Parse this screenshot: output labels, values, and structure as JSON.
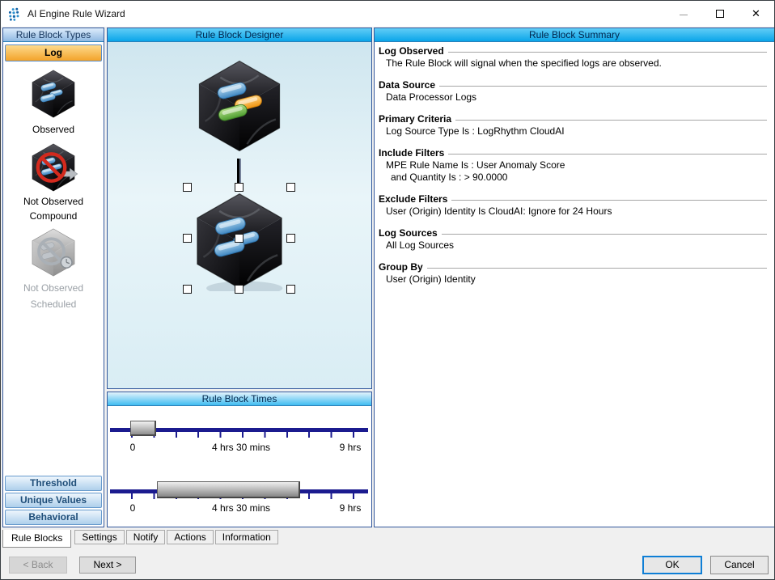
{
  "window": {
    "title": "AI Engine Rule Wizard",
    "icons": {
      "app": "logrhythm-dots-icon",
      "minimize": "minimize-icon",
      "maximize": "maximize-icon",
      "close": "close-icon"
    },
    "close_glyph": "✕"
  },
  "colors": {
    "header_cyan": "#0aa5e9",
    "header_blue": "#8fb8e2",
    "log_button_orange": "#f3a32a",
    "slider_track_navy": "#1b1b8f",
    "prohibit_red": "#d42a1e",
    "pill_blue": "#4a90c8",
    "pill_orange": "#f09410",
    "pill_green": "#4e9e30",
    "ok_focus_border": "#0f7fd6"
  },
  "left_panel": {
    "header": "Rule Block Types",
    "log_button": "Log",
    "items": [
      {
        "label1": "Observed",
        "label2": "",
        "icon": "observed-cube-icon",
        "disabled": false
      },
      {
        "label1": "Not Observed",
        "label2": "Compound",
        "icon": "not-observed-compound-cube-icon",
        "disabled": false
      },
      {
        "label1": "Not Observed",
        "label2": "Scheduled",
        "icon": "not-observed-scheduled-cube-icon",
        "disabled": true
      }
    ],
    "type_buttons": [
      {
        "label": "Threshold"
      },
      {
        "label": "Unique Values"
      },
      {
        "label": "Behavioral"
      }
    ]
  },
  "designer": {
    "header": "Rule Block Designer",
    "icons": {
      "top_cube": "rule-block-cube-icon",
      "bottom_cube": "selected-rule-block-cube-icon"
    }
  },
  "times": {
    "header": "Rule Block Times",
    "sliders": [
      {
        "labels": [
          "0",
          "4 hrs 30 mins",
          "9 hrs"
        ]
      },
      {
        "labels": [
          "0",
          "4 hrs 30 mins",
          "9 hrs"
        ]
      }
    ]
  },
  "summary": {
    "header": "Rule Block Summary",
    "sections": [
      {
        "title": "Log Observed",
        "lines": [
          "The Rule Block will signal when the specified logs are observed."
        ]
      },
      {
        "title": "Data Source",
        "lines": [
          "Data Processor Logs"
        ]
      },
      {
        "title": "Primary Criteria",
        "lines": [
          "Log Source Type Is : LogRhythm CloudAI"
        ]
      },
      {
        "title": "Include Filters",
        "lines": [
          "MPE Rule Name Is : User Anomaly Score",
          "and Quantity Is : > 90.0000"
        ]
      },
      {
        "title": "Exclude Filters",
        "lines": [
          "User (Origin) Identity Is CloudAI: Ignore for 24 Hours"
        ]
      },
      {
        "title": "Log Sources",
        "lines": [
          "All Log Sources"
        ]
      },
      {
        "title": "Group By",
        "lines": [
          "User (Origin) Identity"
        ]
      }
    ]
  },
  "tabs": [
    {
      "label": "Rule Blocks",
      "active": true
    },
    {
      "label": "Settings",
      "active": false
    },
    {
      "label": "Notify",
      "active": false
    },
    {
      "label": "Actions",
      "active": false
    },
    {
      "label": "Information",
      "active": false
    }
  ],
  "footer": {
    "back": "< Back",
    "next": "Next >",
    "ok": "OK",
    "cancel": "Cancel"
  }
}
